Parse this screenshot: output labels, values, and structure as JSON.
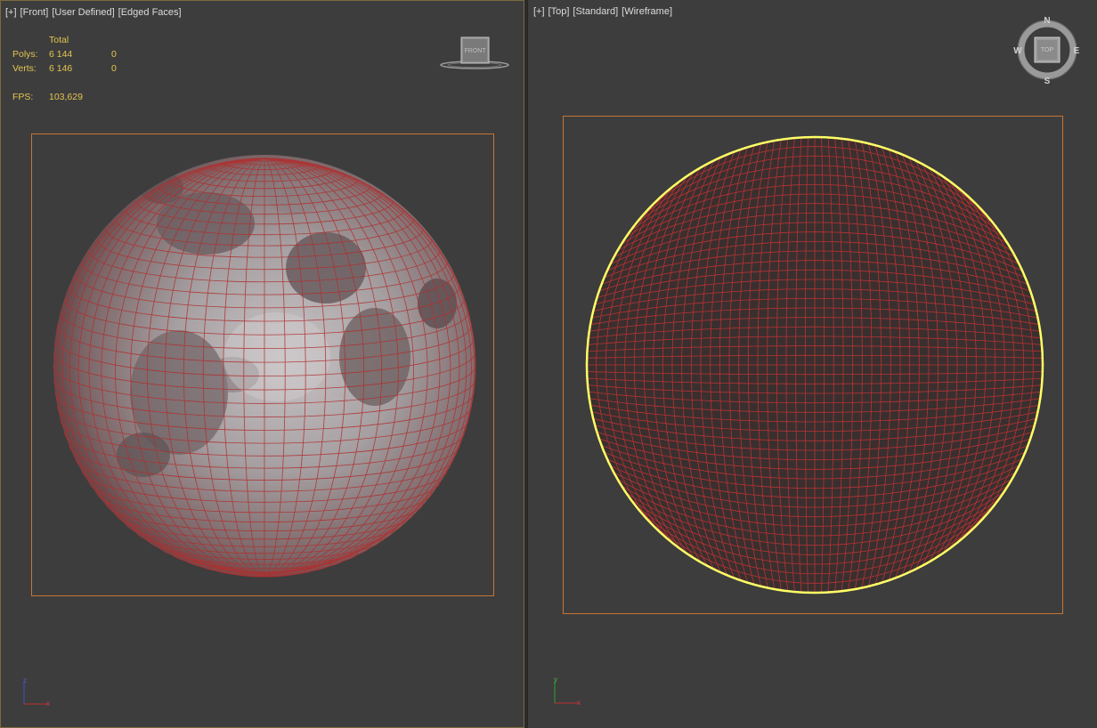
{
  "left_viewport": {
    "label_parts": [
      "[+]",
      "[Front]",
      "[User Defined]",
      "[Edged Faces]"
    ],
    "stats": {
      "header": "Total",
      "polys_label": "Polys:",
      "polys_total": "6 144",
      "polys_selected": "0",
      "verts_label": "Verts:",
      "verts_total": "6 146",
      "verts_selected": "0",
      "fps_label": "FPS:",
      "fps_value": "103,629"
    },
    "navcube_label": "FRONT",
    "axis_labels": {
      "vertical": "z",
      "horizontal": "x"
    }
  },
  "right_viewport": {
    "label_parts": [
      "[+]",
      "[Top]",
      "[Standard]",
      "[Wireframe]"
    ],
    "compass": {
      "north": "N",
      "south": "S",
      "east": "E",
      "west": "W",
      "cube_label": "TOP"
    },
    "axis_labels": {
      "vertical": "y",
      "horizontal": "x"
    }
  },
  "colors": {
    "viewport_bg": "#3d3d3d",
    "wire": "#b03030",
    "selection_bracket": "#c87533",
    "selected_outline": "#ffff66",
    "stats_text": "#e4c550"
  }
}
